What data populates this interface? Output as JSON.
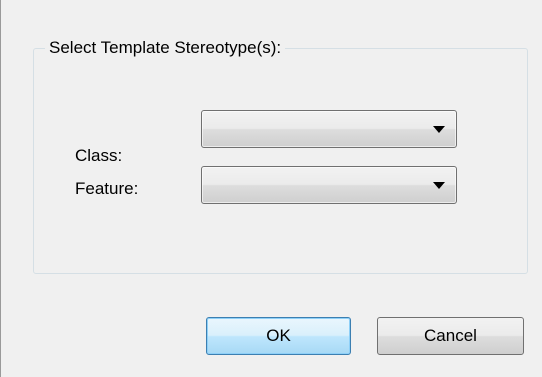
{
  "group": {
    "title": "Select Template Stereotype(s):"
  },
  "fields": {
    "class": {
      "label": "Class:",
      "value": ""
    },
    "feature": {
      "label": "Feature:",
      "value": ""
    }
  },
  "buttons": {
    "ok_label": "OK",
    "cancel_label": "Cancel"
  }
}
